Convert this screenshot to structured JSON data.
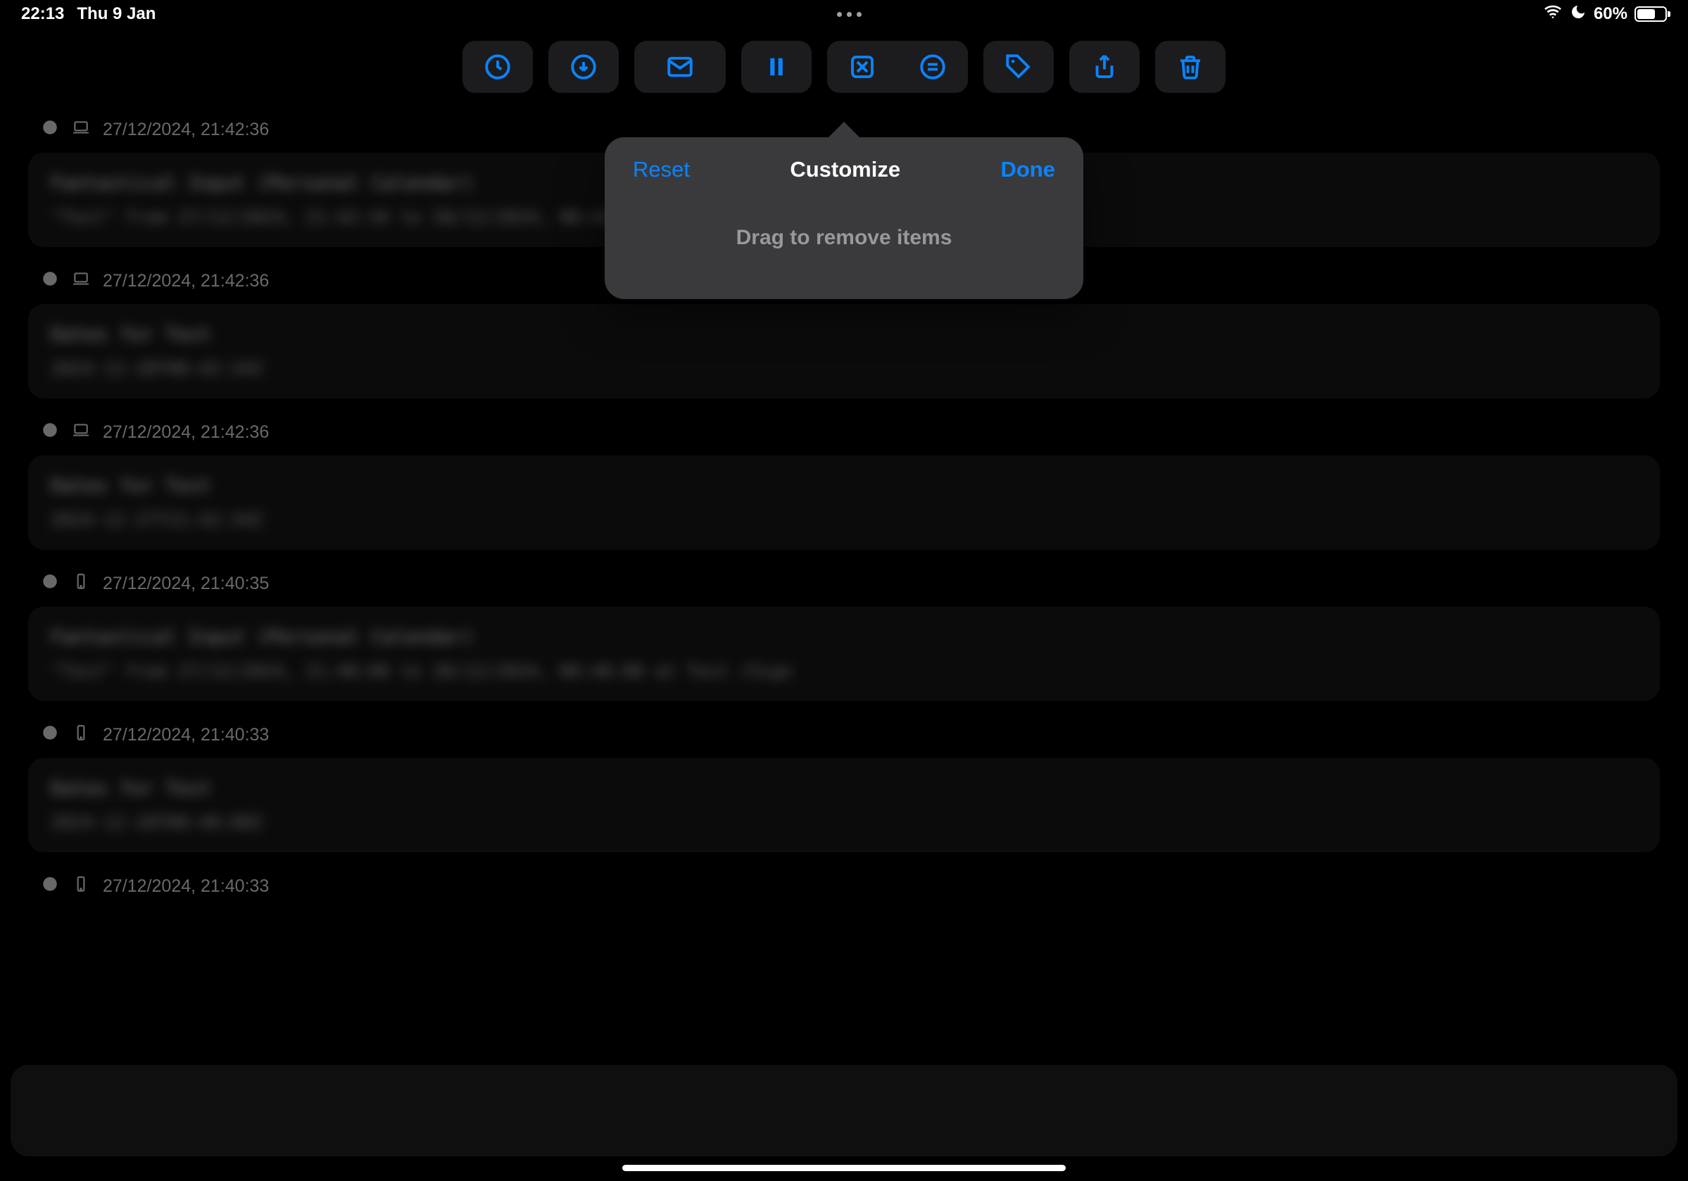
{
  "status": {
    "time": "22:13",
    "date": "Thu 9 Jan",
    "battery_pct": "60%"
  },
  "toolbar": {
    "history": "history",
    "download": "download",
    "mail": "mail",
    "pause": "pause",
    "close_x": "x-in-box",
    "menu_lines": "lines-in-circle",
    "tag": "tag",
    "share": "share",
    "trash": "trash"
  },
  "popover": {
    "reset": "Reset",
    "title": "Customize",
    "done": "Done",
    "body": "Drag to remove items"
  },
  "entries": [
    {
      "device": "laptop",
      "timestamp": "27/12/2024, 21:42:36",
      "title": "Fantastical Input (Personal Calendar)",
      "body": "\"Test\" from 27/12/2024, 21:42:34 to 28/12/2024, 00:42:34 a"
    },
    {
      "device": "laptop",
      "timestamp": "27/12/2024, 21:42:36",
      "title": "Dates for Test",
      "body": "2024-12-28T00:42:34Z"
    },
    {
      "device": "laptop",
      "timestamp": "27/12/2024, 21:42:36",
      "title": "Dates for Test",
      "body": "2024-12-27T21:42:34Z"
    },
    {
      "device": "phone",
      "timestamp": "27/12/2024, 21:40:35",
      "title": "Fantastical Input (Personal Calendar)",
      "body": "\"Test\" from 27/12/2024, 21:40:00 to 28/12/2024, 00:40:00 at Test  /Sign"
    },
    {
      "device": "phone",
      "timestamp": "27/12/2024, 21:40:33",
      "title": "Dates for Test",
      "body": "2024-12-28T00:40:00Z"
    },
    {
      "device": "phone",
      "timestamp": "27/12/2024, 21:40:33",
      "title": "",
      "body": ""
    }
  ],
  "colors": {
    "accent": "#0a84ff",
    "bg": "#000000",
    "card": "#151515",
    "popover": "#3a3a3c"
  }
}
